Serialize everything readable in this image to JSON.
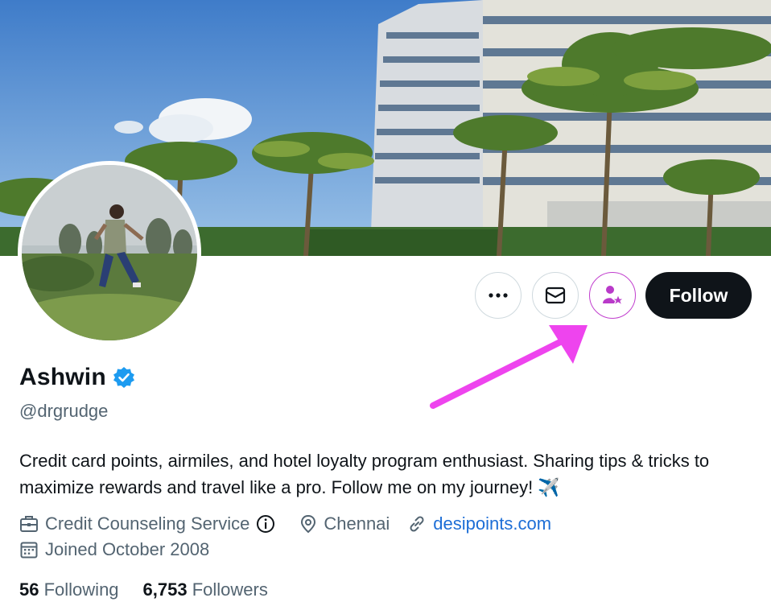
{
  "profile": {
    "name": "Ashwin",
    "handle": "@drgrudge",
    "bio": "Credit card points, airmiles, and hotel loyalty program enthusiast. Sharing tips & tricks to maximize rewards and travel like a pro. Follow me on my journey!",
    "bio_emoji": "✈️",
    "work": "Credit Counseling Service",
    "location": "Chennai",
    "website": "desipoints.com",
    "joined": "Joined October 2008",
    "following_count": "56",
    "following_label": "Following",
    "followers_count": "6,753",
    "followers_label": "Followers"
  },
  "actions": {
    "more_icon": "more-icon",
    "message_icon": "message-icon",
    "subscribe_icon": "subscribe-icon",
    "follow_label": "Follow"
  },
  "colors": {
    "verified": "#1d9bf0",
    "link": "#1d6ed6",
    "highlight_arrow": "#ee44ee",
    "subscribe_ring": "#c13fce",
    "follow_bg": "#0f1419"
  }
}
